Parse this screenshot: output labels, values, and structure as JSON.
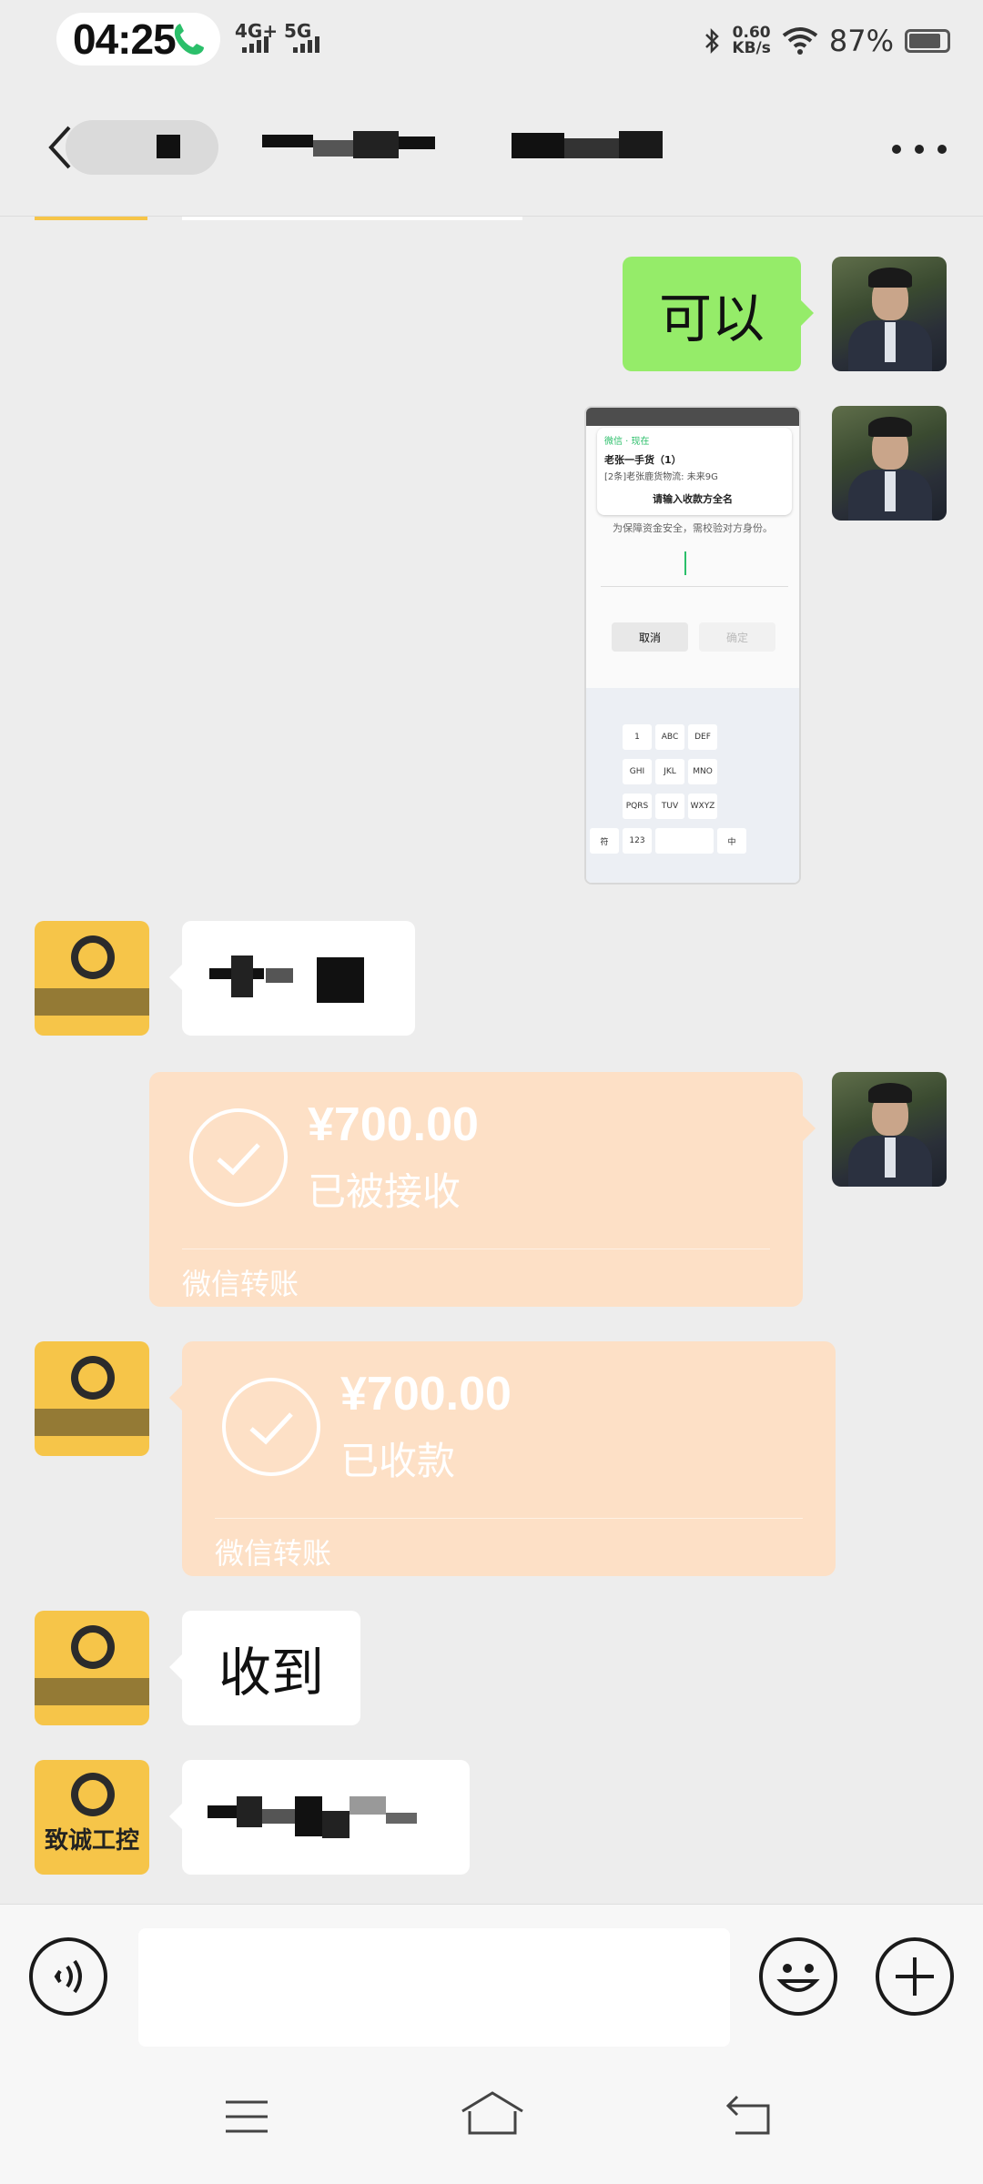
{
  "status_bar": {
    "time": "04:25",
    "network_1": "4G+",
    "network_2": "5G",
    "speed_value": "0.60",
    "speed_unit": "KB/s",
    "battery": "87%"
  },
  "header": {
    "back_icon": "chevron-left-icon",
    "more_icon": "more-dots-icon"
  },
  "messages": [
    {
      "sender": "me",
      "type": "text",
      "text": "可以"
    },
    {
      "sender": "me",
      "type": "image",
      "caption": "screenshot",
      "screenshot": {
        "notif_app": "微信 · 现在",
        "notif_title": "老张一手货（1）",
        "notif_body": "[2条]老张鹿货物流: 未来9G",
        "dialog_title": "请输入收款方全名",
        "dialog_hint": "为保障资金安全，需校验对方身份。",
        "cancel": "取消",
        "confirm": "确定",
        "keys_row1": [
          "1",
          "ABC",
          "DEF"
        ],
        "keys_row2": [
          "GHI",
          "JKL",
          "MNO"
        ],
        "keys_row3": [
          "PQRS",
          "TUV",
          "WXYZ"
        ],
        "keys_row4": [
          "符",
          "123",
          "中"
        ]
      }
    },
    {
      "sender": "other",
      "type": "text",
      "text": ""
    },
    {
      "sender": "me",
      "type": "transfer",
      "amount": "¥700.00",
      "status": "已被接收",
      "label": "微信转账"
    },
    {
      "sender": "other",
      "type": "transfer",
      "amount": "¥700.00",
      "status": "已收款",
      "label": "微信转账"
    },
    {
      "sender": "other",
      "type": "text",
      "text": "收到"
    },
    {
      "sender": "other",
      "type": "text",
      "text": ""
    }
  ],
  "other_avatar_text": "致诚工控",
  "input_bar": {
    "voice_icon": "voice-icon",
    "emoji_icon": "emoji-icon",
    "plus_icon": "plus-icon"
  },
  "nav": {
    "menu_icon": "menu-icon",
    "home_icon": "home-icon",
    "back_icon": "back-icon"
  }
}
